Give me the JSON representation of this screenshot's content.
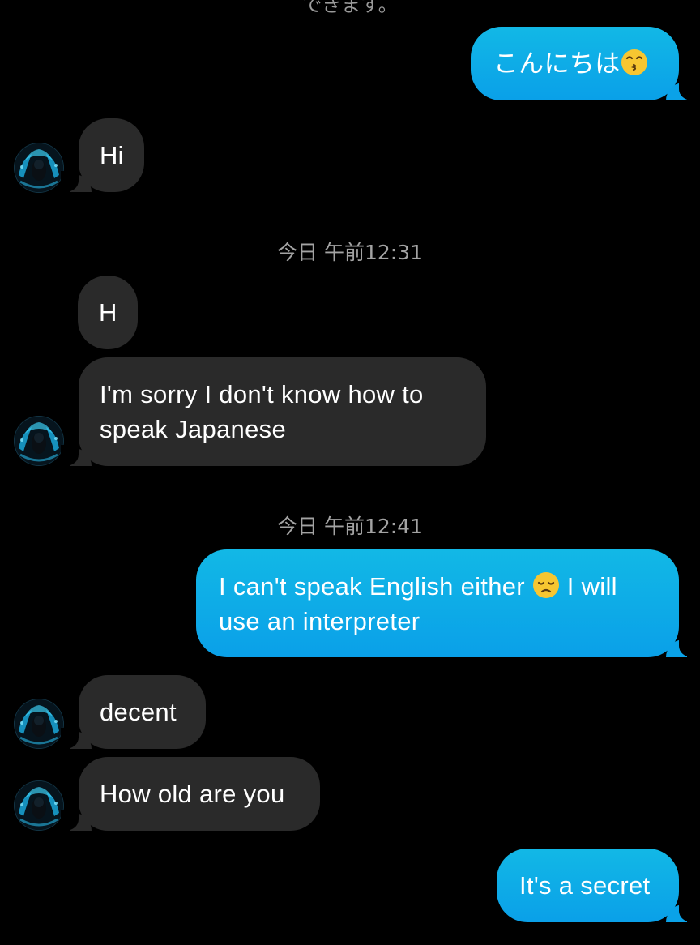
{
  "clipped_header_text": "できます。",
  "messages": [
    {
      "id": "m1",
      "side": "out",
      "text": "こんにちは",
      "emoji": "kissing-face-icon"
    },
    {
      "id": "m2",
      "side": "in",
      "text": "Hi"
    },
    {
      "id": "ts1",
      "type": "timestamp",
      "text": "今日 午前12:31"
    },
    {
      "id": "m3",
      "side": "in",
      "text": "H"
    },
    {
      "id": "m4",
      "side": "in",
      "line1": "I'm sorry I don't know how to",
      "line2": "speak Japanese"
    },
    {
      "id": "ts2",
      "type": "timestamp",
      "text": "今日 午前12:41"
    },
    {
      "id": "m5",
      "side": "out",
      "line1_pre": "I can't speak English either ",
      "emoji": "disappointed-face-icon",
      "line1_post": " I will",
      "line2": "use an interpreter"
    },
    {
      "id": "m6",
      "side": "in",
      "text": "decent"
    },
    {
      "id": "m7",
      "side": "in",
      "text": "How old are you"
    },
    {
      "id": "m8",
      "side": "out",
      "text": "It's a secret"
    }
  ],
  "colors": {
    "background": "#000000",
    "incoming_bubble": "#2a2a2a",
    "outgoing_bubble": "#0aa0e8",
    "timestamp_text": "#a3a3a3"
  }
}
